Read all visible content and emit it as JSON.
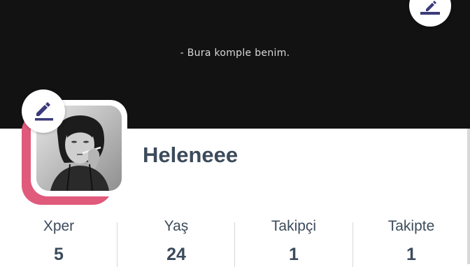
{
  "cover": {
    "bio": "- Bura komple benim.",
    "background_color": "#121212",
    "edit_icon": "pencil-edit-icon"
  },
  "profile": {
    "username": "Heleneee",
    "avatar_accent_color": "#e05a7b",
    "avatar_image": "black-and-white portrait photo",
    "edit_icon": "pencil-edit-icon"
  },
  "stats": [
    {
      "label": "Xper",
      "value": "5"
    },
    {
      "label": "Yaş",
      "value": "24"
    },
    {
      "label": "Takipçi",
      "value": "1"
    },
    {
      "label": "Takipte",
      "value": "1"
    }
  ],
  "colors": {
    "text": "#3c4b5c",
    "icon": "#3b3a7a",
    "divider": "#d4d7dc"
  }
}
